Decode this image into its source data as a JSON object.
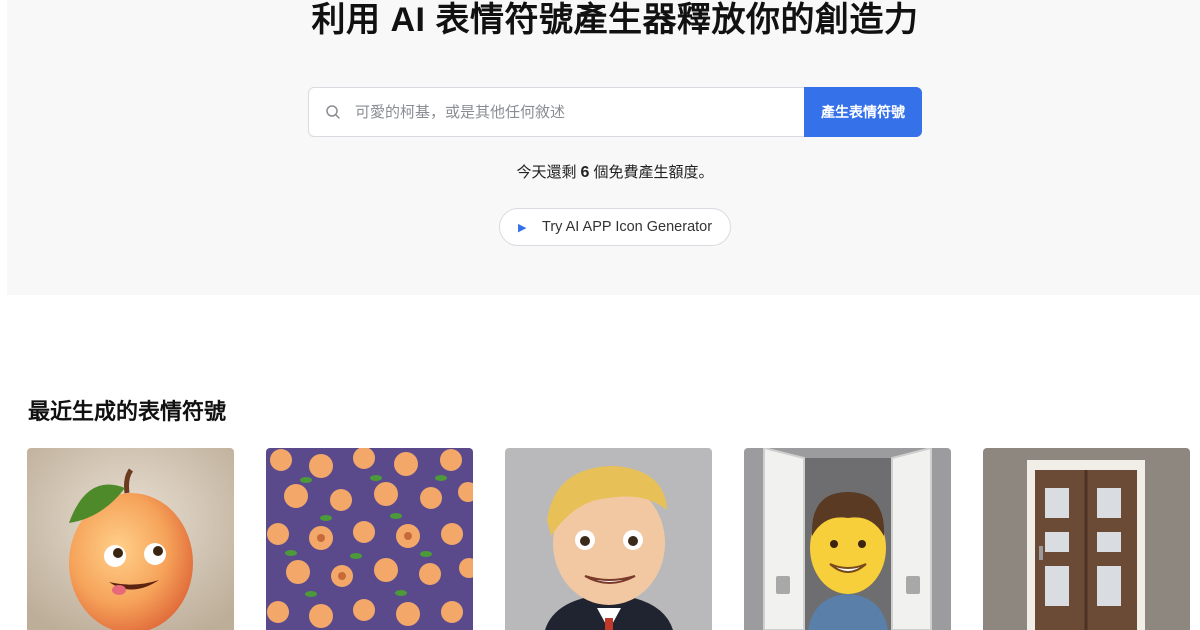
{
  "hero": {
    "title": "利用 AI 表情符號產生器釋放你的創造力",
    "search_placeholder": "可愛的柯基，或是其他任何敘述",
    "generate_button": "產生表情符號",
    "quota_prefix": "今天還剩",
    "quota_count": "6",
    "quota_suffix": "個免費產生額度。",
    "try_label": "Try AI APP Icon Generator",
    "accent_color": "#3571e9"
  },
  "recent": {
    "title": "最近生成的表情符號",
    "items": [
      {
        "icon": "peach-face-emoji"
      },
      {
        "icon": "peach-pattern-emoji"
      },
      {
        "icon": "blond-man-emoji"
      },
      {
        "icon": "man-in-doorway-emoji"
      },
      {
        "icon": "door-emoji"
      }
    ]
  }
}
